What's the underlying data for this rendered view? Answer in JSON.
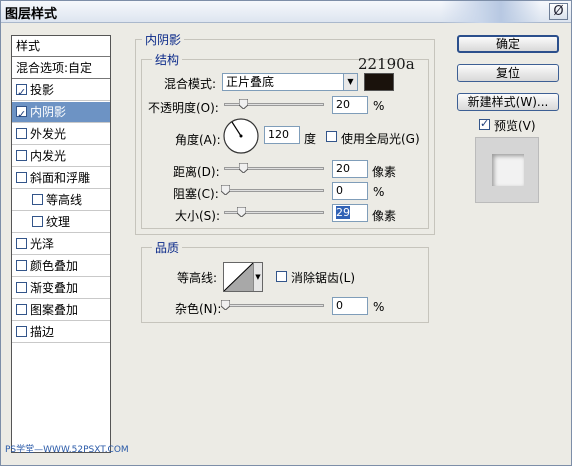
{
  "window": {
    "title": "图层样式",
    "close_label": "Ø"
  },
  "left_panel": {
    "header": "样式",
    "blend_options": "混合选项:自定",
    "items": [
      {
        "label": "投影",
        "checked": true
      },
      {
        "label": "内阴影",
        "checked": true,
        "selected": true
      },
      {
        "label": "外发光",
        "checked": false
      },
      {
        "label": "内发光",
        "checked": false
      },
      {
        "label": "斜面和浮雕",
        "checked": false
      },
      {
        "label": "等高线",
        "checked": false,
        "sub": true
      },
      {
        "label": "纹理",
        "checked": false,
        "sub": true
      },
      {
        "label": "光泽",
        "checked": false
      },
      {
        "label": "颜色叠加",
        "checked": false
      },
      {
        "label": "渐变叠加",
        "checked": false
      },
      {
        "label": "图案叠加",
        "checked": false
      },
      {
        "label": "描边",
        "checked": false
      }
    ]
  },
  "inner_shadow": {
    "title": "内阴影",
    "structure": {
      "title": "结构",
      "blend_mode_label": "混合模式:",
      "blend_mode_value": "正片叠底",
      "color_code": "22190a",
      "opacity_label": "不透明度(O):",
      "opacity_value": "20",
      "opacity_unit": "%",
      "angle_label": "角度(A):",
      "angle_value": "120",
      "angle_unit": "度",
      "global_light_label": "使用全局光(G)",
      "global_light_checked": false,
      "distance_label": "距离(D):",
      "distance_value": "20",
      "distance_unit": "像素",
      "choke_label": "阻塞(C):",
      "choke_value": "0",
      "choke_unit": "%",
      "size_label": "大小(S):",
      "size_value": "29",
      "size_unit": "像素"
    },
    "quality": {
      "title": "品质",
      "contour_label": "等高线:",
      "anti_alias_label": "消除锯齿(L)",
      "anti_alias_checked": false,
      "noise_label": "杂色(N):",
      "noise_value": "0",
      "noise_unit": "%"
    }
  },
  "buttons": {
    "ok": "确定",
    "reset": "复位",
    "new_style": "新建样式(W)...",
    "preview_label": "预览(V)",
    "preview_checked": true
  },
  "watermark": "PS学堂—WWW.52PSXT.COM",
  "colors": {
    "selected_bg": "#6d93c4",
    "group_title": "#0b2a8a",
    "shadow_color": "#1a120c"
  }
}
